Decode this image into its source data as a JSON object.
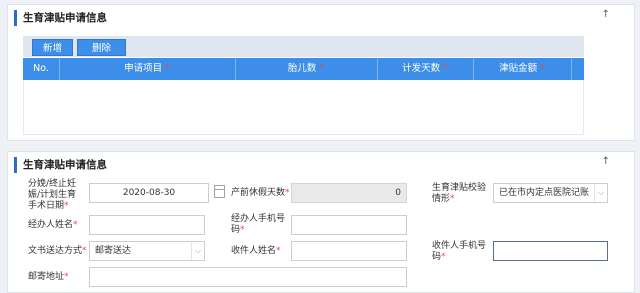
{
  "section1": {
    "title": "生育津贴申请信息",
    "up_icon": "↑",
    "buttons": {
      "add": "新增",
      "delete": "删除"
    },
    "columns": [
      {
        "label": "No.",
        "required": false
      },
      {
        "label": "申请项目",
        "required": true
      },
      {
        "label": "胎儿数",
        "required": true
      },
      {
        "label": "计发天数",
        "required": true
      },
      {
        "label": "津贴金额",
        "required": true
      }
    ],
    "rows": []
  },
  "section2": {
    "title": "生育津贴申请信息",
    "up_icon": "↑",
    "required_mark": "*",
    "fields": {
      "end_date": {
        "label_l1": "分娩/终止妊",
        "label_l2": "娠/计划生育",
        "label_l3": "手术日期",
        "value": "2020-08-30"
      },
      "prenatal_days": {
        "label": "产前休假天数",
        "value": "0"
      },
      "verify_situation": {
        "label_l1": "生育津贴校验",
        "label_l2": "情形",
        "value": "已在市内定点医院记账"
      },
      "agent_name": {
        "label": "经办人姓名",
        "value": ""
      },
      "agent_phone": {
        "label_l1": "经办人手机号",
        "label_l2": "码",
        "value": ""
      },
      "delivery_method": {
        "label": "文书送达方式",
        "value": "邮寄送达"
      },
      "recipient_name": {
        "label": "收件人姓名",
        "value": ""
      },
      "recipient_phone": {
        "label_l1": "收件人手机号",
        "label_l2": "码",
        "value": ""
      },
      "mail_address": {
        "label": "邮寄地址",
        "value": ""
      }
    }
  }
}
